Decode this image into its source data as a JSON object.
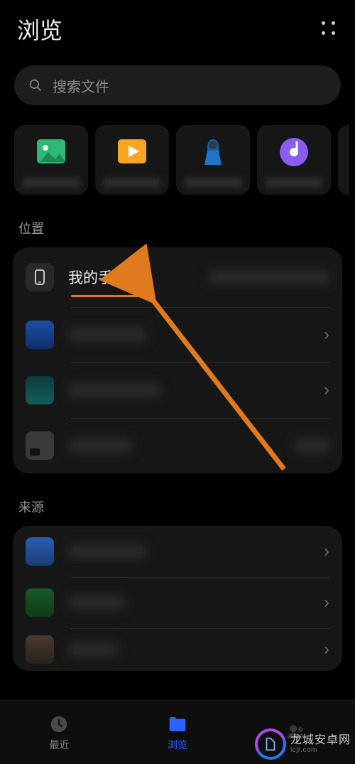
{
  "header": {
    "title": "浏览"
  },
  "search": {
    "placeholder": "搜索文件"
  },
  "categories": [
    {
      "name": "images"
    },
    {
      "name": "videos"
    },
    {
      "name": "audio"
    },
    {
      "name": "music"
    }
  ],
  "sections": {
    "locations": {
      "label": "位置",
      "items": [
        {
          "title": "我的手机",
          "icon": "phone",
          "hasChevron": false,
          "highlighted": true
        },
        {
          "title": "",
          "icon": "blue-folder",
          "hasChevron": true
        },
        {
          "title": "",
          "icon": "teal-folder",
          "hasChevron": true
        },
        {
          "title": "",
          "icon": "gray-app",
          "hasChevron": false
        }
      ]
    },
    "sources": {
      "label": "来源",
      "items": [
        {
          "title": "",
          "icon": "blue-sq",
          "hasChevron": true
        },
        {
          "title": "",
          "icon": "green-sq",
          "hasChevron": true
        },
        {
          "title": "",
          "icon": "brown-sq",
          "hasChevron": true
        }
      ]
    }
  },
  "nav": {
    "items": [
      {
        "label": "最近",
        "icon": "clock",
        "active": false
      },
      {
        "label": "浏览",
        "icon": "folder",
        "active": true
      },
      {
        "label": "",
        "icon": "people",
        "active": false
      }
    ]
  },
  "watermark": {
    "line1": "龙城安卓网",
    "line2": "lcjr.com"
  }
}
